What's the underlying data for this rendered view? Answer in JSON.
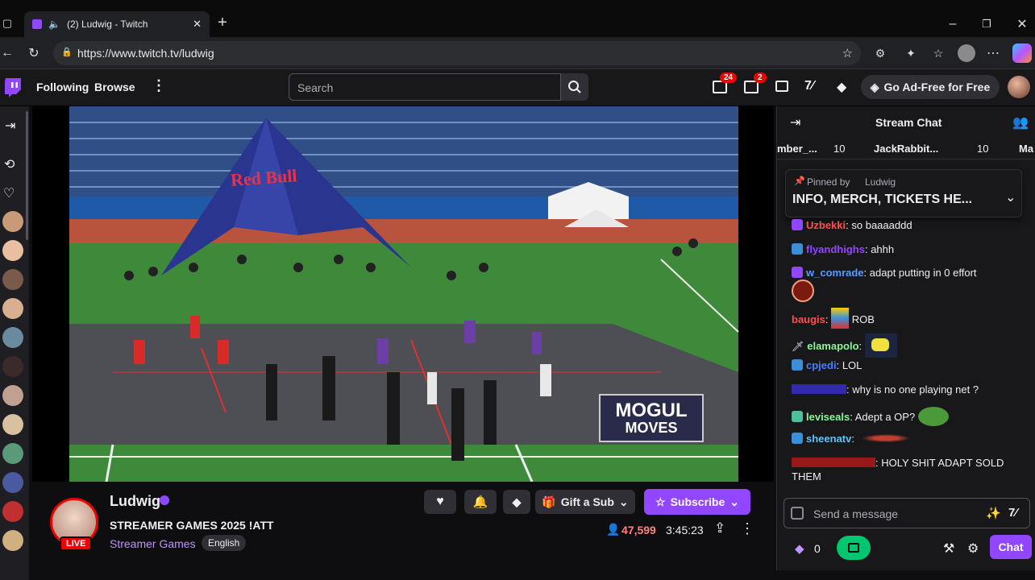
{
  "browser": {
    "tab_title": "(2) Ludwig - Twitch",
    "url": "https://www.twitch.tv/ludwig"
  },
  "nav": {
    "following": "Following",
    "browse": "Browse",
    "search_placeholder": "Search",
    "notifications_count": "24",
    "whispers_count": "2",
    "ad_free": "Go Ad-Free for Free"
  },
  "video": {
    "tent_text": "Red Bull",
    "overlay_line1": "MOGUL",
    "overlay_line2": "MOVES"
  },
  "stream": {
    "streamer": "Ludwig",
    "title": "STREAMER GAMES 2025 !ATT",
    "category": "Streamer Games",
    "language": "English",
    "live_label": "LIVE",
    "viewers": "47,599",
    "uptime": "3:45:23",
    "gift_sub": "Gift a Sub",
    "subscribe": "Subscribe"
  },
  "chat": {
    "header": "Stream Chat",
    "leaderboard": [
      {
        "name": "mber_...",
        "count": "10"
      },
      {
        "name": "JackRabbit...",
        "count": "10"
      },
      {
        "name": "Ma",
        "count": ""
      }
    ],
    "pinned_by_label": "Pinned by",
    "pinned_by_user": "Ludwig",
    "pinned_text": "INFO, MERCH, TICKETS HE...",
    "messages": [
      {
        "user": "Uzbekki",
        "text": "so baaaaddd",
        "color": "#ff4f4d"
      },
      {
        "user": "flyandhighs",
        "text": "ahhh",
        "color": "#9147ff"
      },
      {
        "user": "w_comrade",
        "text": "adapt putting in 0 effort",
        "color": "#5c9aff"
      },
      {
        "user": "baugis",
        "text": "ROB",
        "color": "#ff4f4d"
      },
      {
        "user": "elamapolo",
        "text": "",
        "color": "#8cf59a"
      },
      {
        "user": "cpjedi",
        "text": "LOL",
        "color": "#4c7dff"
      },
      {
        "user": "",
        "text": "why is no one playing net ?",
        "color": "#4a3fff"
      },
      {
        "user": "leviseals",
        "text": "Adept a OP?",
        "color": "#8cf59a"
      },
      {
        "user": "sheenatv",
        "text": "",
        "color": "#58c6ff"
      },
      {
        "user": "",
        "text": "HOLY SHIT ADAPT SOLD THEM",
        "color": "#ff2a2a"
      }
    ],
    "input_placeholder": "Send a message",
    "points": "0",
    "chat_button": "Chat"
  },
  "colors": {
    "twitch_purple": "#9147ff",
    "live_red": "#eb0400",
    "viewer_red": "#ff8280"
  }
}
